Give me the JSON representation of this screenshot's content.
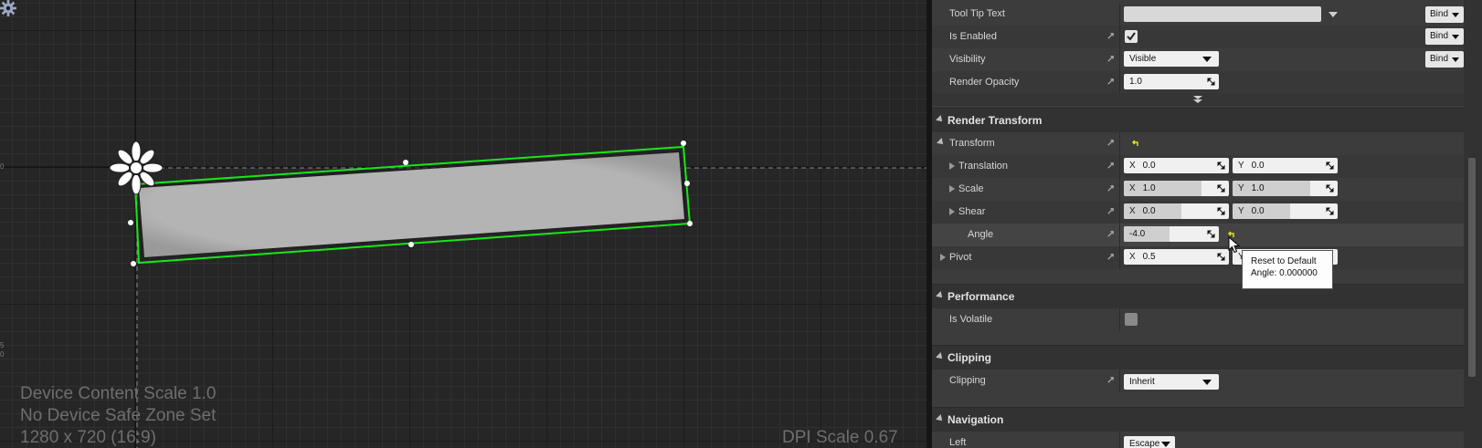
{
  "viewport": {
    "info_lines": [
      "Device Content Scale 1.0",
      "No Device Safe Zone Set",
      "1280 x 720 (16:9)"
    ],
    "dpi_scale": "DPI Scale 0.67",
    "ruler_marks": [
      "0",
      "5",
      "0"
    ],
    "colors": {
      "selection": "#19e619",
      "widget_fill": "#b4b4b4"
    }
  },
  "details": {
    "behavior_rows": [
      {
        "label": "Tool Tip Text",
        "value": "",
        "bind": "Bind"
      },
      {
        "label": "Is Enabled",
        "checked": true,
        "bind": "Bind"
      },
      {
        "label": "Visibility",
        "value": "Visible",
        "bind": "Bind"
      },
      {
        "label": "Render Opacity",
        "value": "1.0"
      }
    ],
    "render_transform": {
      "title": "Render Transform",
      "transform_label": "Transform",
      "translation": {
        "label": "Translation",
        "x_axis": "X",
        "x": "0.0",
        "y_axis": "Y",
        "y": "0.0"
      },
      "scale": {
        "label": "Scale",
        "x_axis": "X",
        "x": "1.0",
        "y_axis": "Y",
        "y": "1.0"
      },
      "shear": {
        "label": "Shear",
        "x_axis": "X",
        "x": "0.0",
        "y_axis": "Y",
        "y": "0.0"
      },
      "angle": {
        "label": "Angle",
        "value": "-4.0"
      },
      "pivot": {
        "label": "Pivot",
        "x_axis": "X",
        "x": "0.5",
        "y_axis": "Y"
      }
    },
    "performance": {
      "title": "Performance",
      "is_volatile_label": "Is Volatile",
      "is_volatile": false
    },
    "clipping": {
      "title": "Clipping",
      "label": "Clipping",
      "value": "Inherit"
    },
    "navigation": {
      "title": "Navigation",
      "left_label": "Left",
      "left_value": "Escape"
    }
  },
  "tooltip": {
    "line1": "Reset to Default",
    "line2": "Angle: 0.000000"
  }
}
